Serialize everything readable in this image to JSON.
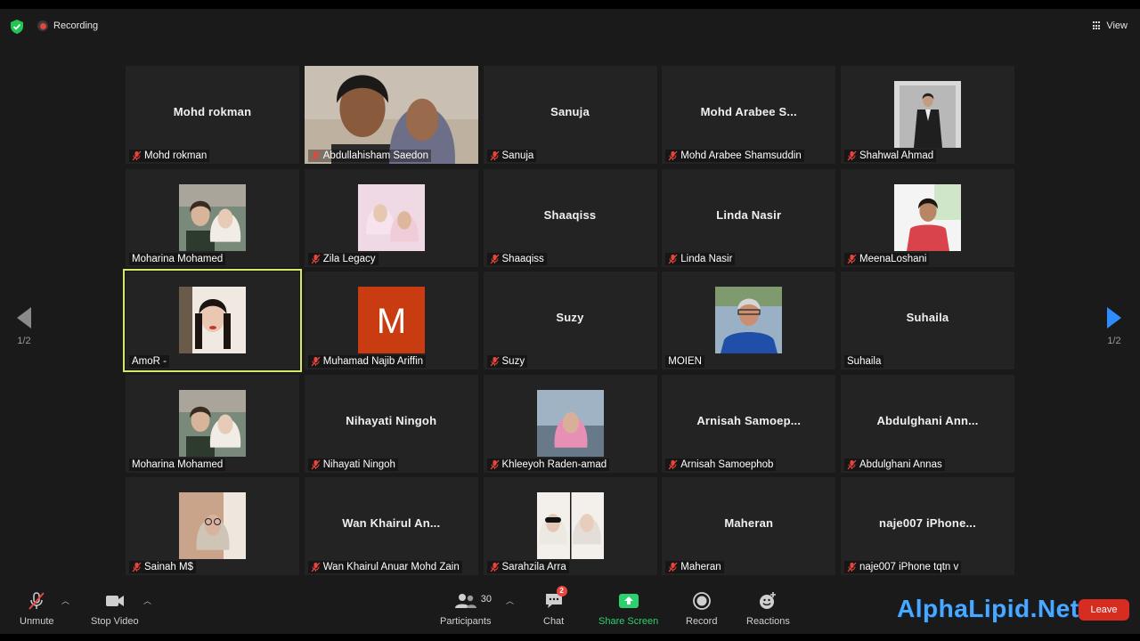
{
  "topbar": {
    "recording_label": "Recording",
    "view_label": "View"
  },
  "pagination": {
    "left": "1/2",
    "right": "1/2"
  },
  "tiles": [
    {
      "big": "Mohd rokman",
      "label": "Mohd rokman",
      "muted": true,
      "photo": "none"
    },
    {
      "big": "",
      "label": "Abdullahisham Saedon",
      "muted": true,
      "photo": "couple-selfie-full"
    },
    {
      "big": "Sanuja",
      "label": "Sanuja",
      "muted": true,
      "photo": "none"
    },
    {
      "big": "Mohd Arabee S...",
      "label": "Mohd Arabee Shamsuddin",
      "muted": true,
      "photo": "none"
    },
    {
      "big": "",
      "label": "Shahwal Ahmad",
      "muted": true,
      "photo": "man-in-suit"
    },
    {
      "big": "",
      "label": "Moharina Mohamed",
      "muted": false,
      "photo": "couple-portrait"
    },
    {
      "big": "",
      "label": "Zila Legacy",
      "muted": true,
      "photo": "two-women-hijab"
    },
    {
      "big": "Shaaqiss",
      "label": "Shaaqiss",
      "muted": true,
      "photo": "none"
    },
    {
      "big": "Linda Nasir",
      "label": "Linda Nasir",
      "muted": true,
      "photo": "none"
    },
    {
      "big": "",
      "label": "MeenaLoshani",
      "muted": true,
      "photo": "woman-red-top"
    },
    {
      "big": "",
      "label": "AmoR -",
      "muted": false,
      "photo": "woman-portrait",
      "active": true
    },
    {
      "big": "",
      "label": "Muhamad Najib Ariffin",
      "muted": true,
      "photo": "letter-avatar",
      "letter": "M"
    },
    {
      "big": "Suzy",
      "label": "Suzy",
      "muted": true,
      "photo": "none"
    },
    {
      "big": "",
      "label": "MOIEN",
      "muted": false,
      "photo": "man-blue-shirt"
    },
    {
      "big": "Suhaila",
      "label": "Suhaila",
      "muted": false,
      "photo": "none"
    },
    {
      "big": "",
      "label": "Moharina Mohamed",
      "muted": false,
      "photo": "couple-portrait"
    },
    {
      "big": "Nihayati Ningoh",
      "label": "Nihayati Ningoh",
      "muted": true,
      "photo": "none"
    },
    {
      "big": "",
      "label": "Khleeyoh Raden-amad",
      "muted": true,
      "photo": "woman-pink-hijab"
    },
    {
      "big": "Arnisah Samoep...",
      "label": "Arnisah Samoephob",
      "muted": true,
      "photo": "none"
    },
    {
      "big": "Abdulghani Ann...",
      "label": "Abdulghani Annas",
      "muted": true,
      "photo": "none"
    },
    {
      "big": "",
      "label": "Sainah M$",
      "muted": true,
      "photo": "woman-glasses-hijab"
    },
    {
      "big": "Wan Khairul An...",
      "label": "Wan Khairul Anuar Mohd Zain",
      "muted": true,
      "photo": "none"
    },
    {
      "big": "",
      "label": "Sarahzila Arra",
      "muted": true,
      "photo": "two-women-split"
    },
    {
      "big": "Maheran",
      "label": "Maheran",
      "muted": true,
      "photo": "none"
    },
    {
      "big": "naje007  iPhone...",
      "label": "naje007 iPhone tqtn  v",
      "muted": true,
      "photo": "none"
    }
  ],
  "toolbar": {
    "unmute": "Unmute",
    "stop_video": "Stop Video",
    "participants": "Participants",
    "participants_count": "30",
    "chat": "Chat",
    "chat_badge": "2",
    "share_screen": "Share Screen",
    "record": "Record",
    "reactions": "Reactions",
    "leave": "Leave"
  },
  "watermark": "AlphaLipid.Net",
  "colors": {
    "active_border": "#d4e86a",
    "share_green": "#2bd16f",
    "leave_red": "#d72c20",
    "nav_blue": "#2d8cff",
    "muted_red": "#e8453c"
  }
}
